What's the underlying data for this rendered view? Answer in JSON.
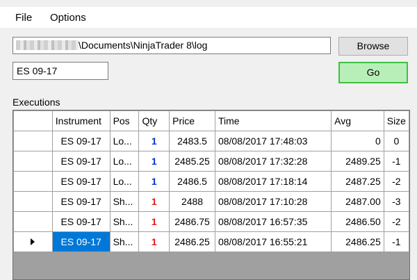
{
  "menu": {
    "file": "File",
    "options": "Options"
  },
  "path": {
    "visible_text": "\\Documents\\NinjaTrader 8\\log"
  },
  "browse_label": "Browse",
  "instrument_value": "ES 09-17",
  "go_label": "Go",
  "executions_label": "Executions",
  "columns": [
    "Instrument",
    "Pos",
    "Qty",
    "Price",
    "Time",
    "Avg",
    "Size"
  ],
  "rows": [
    {
      "instrument": "ES 09-17",
      "pos": "Lo...",
      "qty": "1",
      "side": "buy",
      "price": "2483.5",
      "time": "08/08/2017 17:48:03",
      "avg": "0",
      "size": "0"
    },
    {
      "instrument": "ES 09-17",
      "pos": "Lo...",
      "qty": "1",
      "side": "buy",
      "price": "2485.25",
      "time": "08/08/2017 17:32:28",
      "avg": "2489.25",
      "size": "-1"
    },
    {
      "instrument": "ES 09-17",
      "pos": "Lo...",
      "qty": "1",
      "side": "buy",
      "price": "2486.5",
      "time": "08/08/2017 17:18:14",
      "avg": "2487.25",
      "size": "-2"
    },
    {
      "instrument": "ES 09-17",
      "pos": "Sh...",
      "qty": "1",
      "side": "sell",
      "price": "2488",
      "time": "08/08/2017 17:10:28",
      "avg": "2487.00",
      "size": "-3"
    },
    {
      "instrument": "ES 09-17",
      "pos": "Sh...",
      "qty": "1",
      "side": "sell",
      "price": "2486.75",
      "time": "08/08/2017 16:57:35",
      "avg": "2486.50",
      "size": "-2"
    },
    {
      "instrument": "ES 09-17",
      "pos": "Sh...",
      "qty": "1",
      "side": "sell",
      "price": "2486.25",
      "time": "08/08/2017 16:55:21",
      "avg": "2486.25",
      "size": "-1"
    }
  ],
  "selected_row": 5,
  "colors": {
    "buy": "#0033cc",
    "sell": "#e21b1b",
    "selection": "#0078d7",
    "go_border": "#3fbf3f",
    "go_fill": "#b8efb8"
  }
}
